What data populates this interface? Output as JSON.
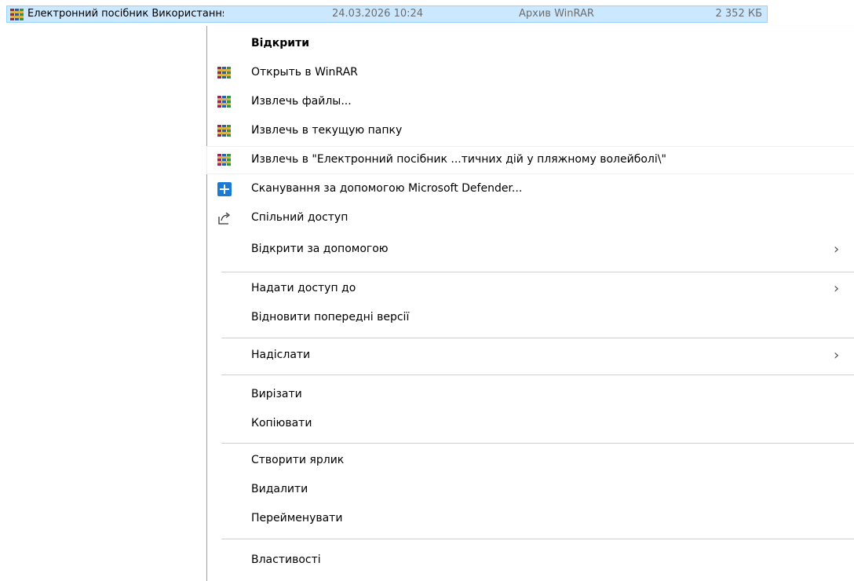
{
  "file": {
    "name": "Електронний посібник Використання т...",
    "date": "24.03.2026 10:24",
    "type": "Архив WinRAR",
    "size": "2 352 КБ",
    "icon": "winrar-archive-icon"
  },
  "menu": {
    "items": [
      {
        "label": "Відкрити",
        "bold": true,
        "icon": "none"
      },
      {
        "label": "Открыть в WinRAR",
        "icon": "winrar-icon"
      },
      {
        "label": "Извлечь файлы...",
        "icon": "winrar-icon"
      },
      {
        "label": "Извлечь в текущую папку",
        "icon": "winrar-icon"
      },
      {
        "label": "Извлечь в \"Електронний посібник ...тичних дій у пляжному волейболі\\\"",
        "icon": "winrar-icon"
      },
      {
        "label": "Сканування за допомогою Microsoft Defender...",
        "icon": "defender-icon"
      },
      {
        "label": "Спільний доступ",
        "icon": "share-icon"
      },
      {
        "label": "Відкрити за допомогою",
        "icon": "none",
        "submenu": true
      },
      {
        "label": "Надати доступ до",
        "icon": "none",
        "submenu": true
      },
      {
        "label": "Відновити попередні версії",
        "icon": "none"
      },
      {
        "label": "Надіслати",
        "icon": "none",
        "submenu": true
      },
      {
        "label": "Вирізати",
        "icon": "none"
      },
      {
        "label": "Копіювати",
        "icon": "none"
      },
      {
        "label": "Створити ярлик",
        "icon": "none"
      },
      {
        "label": "Видалити",
        "icon": "none"
      },
      {
        "label": "Перейменувати",
        "icon": "none"
      },
      {
        "label": "Властивості",
        "icon": "none"
      }
    ],
    "submenu_chevron": "›"
  },
  "colors": {
    "selection_bg": "#cce8ff",
    "selection_border": "#99d1ff",
    "separator": "#d0d0d0",
    "defender_blue": "#1a7ad4"
  }
}
